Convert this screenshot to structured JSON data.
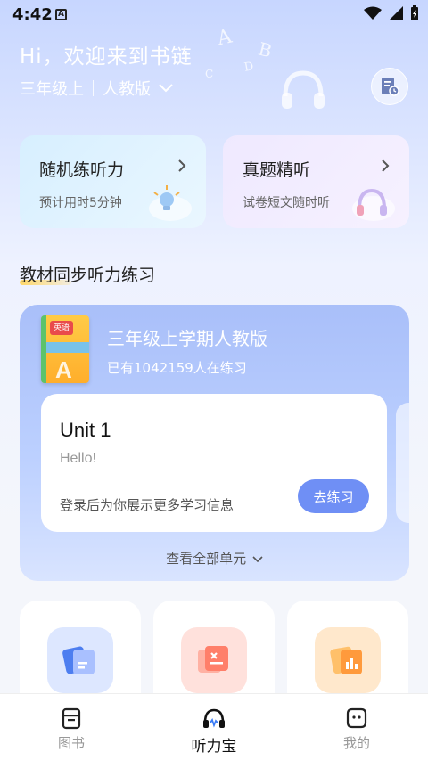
{
  "status": {
    "time": "4:42",
    "notif": "A"
  },
  "header": {
    "greeting": "Hi，欢迎来到书链",
    "grade": "三年级上",
    "edition": "人教版",
    "deco_letters": [
      "A",
      "B",
      "C",
      "D"
    ]
  },
  "quick_cards": [
    {
      "title": "随机练听力",
      "subtitle": "预计用时5分钟",
      "color": "#d7efff"
    },
    {
      "title": "真题精听",
      "subtitle": "试卷短文随时听",
      "color": "#efe9ff"
    }
  ],
  "section": {
    "title": "教材同步听力练习"
  },
  "book": {
    "cover_tag": "英语",
    "cover_letter": "A",
    "title": "三年级上学期人教版",
    "count": "已有1042159人在练习"
  },
  "unit": {
    "title": "Unit 1",
    "subtitle": "Hello!",
    "hint": "登录后为你展示更多学习信息",
    "button": "去练习"
  },
  "view_all": "查看全部单元",
  "tools": [
    {
      "icon": "cards-icon",
      "color": "#dde7ff"
    },
    {
      "icon": "calculator-icon",
      "color": "#ffe1dc"
    },
    {
      "icon": "chart-icon",
      "color": "#ffe8cc"
    }
  ],
  "tabs": [
    {
      "label": "图书",
      "icon": "book-icon",
      "active": false
    },
    {
      "label": "听力宝",
      "icon": "headphones-icon",
      "active": true
    },
    {
      "label": "我的",
      "icon": "face-icon",
      "active": false
    }
  ],
  "colors": {
    "accent": "#6f8ff5",
    "panel": "#a9bff9"
  }
}
